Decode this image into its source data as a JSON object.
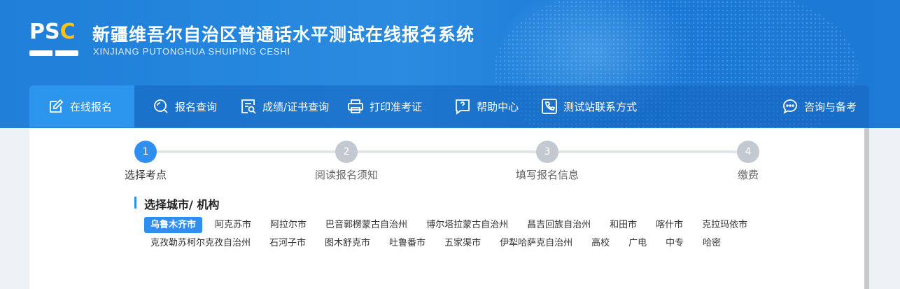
{
  "brand": {
    "logo_text_p": "P",
    "logo_text_s": "S",
    "logo_text_c": "C",
    "title": "新疆维吾尔自治区普通话水平测试在线报名系统",
    "subtitle": "XINJIANG PUTONGHUA SHUIPING CESHI",
    "accent_color": "#f7c21a"
  },
  "nav": {
    "items": [
      {
        "label": "在线报名",
        "icon": "edit-icon",
        "active": true
      },
      {
        "label": "报名查询",
        "icon": "search-circle-icon"
      },
      {
        "label": "成绩/证书查询",
        "icon": "document-search-icon"
      },
      {
        "label": "打印准考证",
        "icon": "printer-icon"
      },
      {
        "label": "帮助中心",
        "icon": "help-chat-icon"
      },
      {
        "label": "测试站联系方式",
        "icon": "phone-icon"
      }
    ],
    "right_item": {
      "label": "咨询与备考",
      "icon": "chat-bubble-icon"
    }
  },
  "steps": [
    {
      "number": "1",
      "label": "选择考点",
      "active": true
    },
    {
      "number": "2",
      "label": "阅读报名须知"
    },
    {
      "number": "3",
      "label": "填写报名信息"
    },
    {
      "number": "4",
      "label": "缴费"
    }
  ],
  "section": {
    "title": "选择城市/ 机构"
  },
  "cities": [
    "乌鲁木齐市",
    "阿克苏市",
    "阿拉尔市",
    "巴音郭楞蒙古自治州",
    "博尔塔拉蒙古自治州",
    "昌吉回族自治州",
    "和田市",
    "喀什市",
    "克拉玛依市",
    "克孜勒苏柯尔克孜自治州",
    "石河子市",
    "图木舒克市",
    "吐鲁番市",
    "五家渠市",
    "伊犁哈萨克自治州",
    "高校",
    "广电",
    "中专",
    "哈密"
  ],
  "selected_city": "乌鲁木齐市",
  "colors": {
    "primary": "#2f8ef0",
    "header": "#1f7fd9",
    "step_inactive": "#c3c9d0"
  }
}
